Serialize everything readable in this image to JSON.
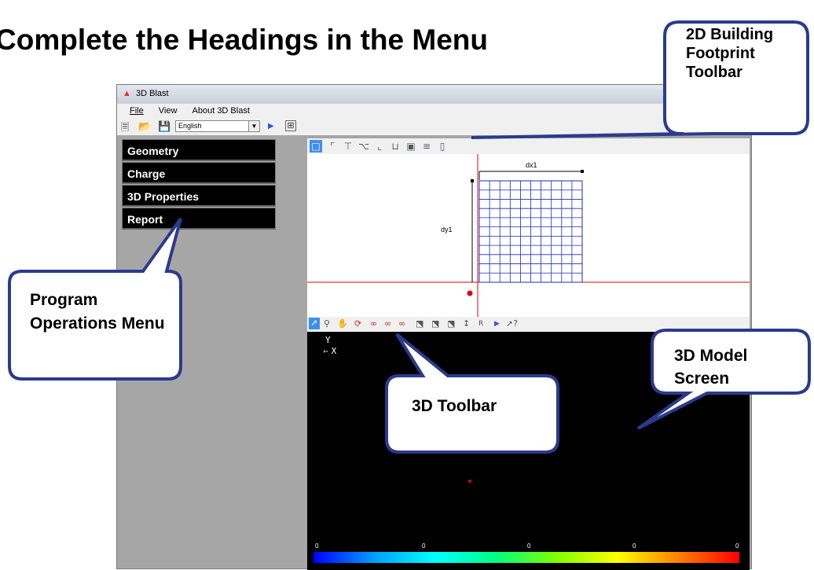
{
  "slide": {
    "title": "Complete the Headings in the Menu"
  },
  "window": {
    "title": "3D Blast",
    "menus": [
      "File",
      "View",
      "About 3D Blast"
    ],
    "language": "English"
  },
  "left_menu": {
    "items": [
      "Geometry",
      "Charge",
      "3D Properties",
      "Report"
    ]
  },
  "footprint": {
    "dx_label": "dx1",
    "dy_label": "dy1"
  },
  "screen3d": {
    "axis_y": "Y",
    "axis_x": "X",
    "scale_labels": [
      "0",
      "0",
      "0",
      "0",
      "0"
    ]
  },
  "callouts": {
    "footprint_toolbar": "2D Building Footprint Toolbar",
    "program_menu": "Program Operations Menu",
    "toolbar_3d": "3D Toolbar",
    "model_screen": "3D Model Screen"
  },
  "icons": [
    "new-file-icon",
    "open-folder-icon",
    "save-icon",
    "play-icon",
    "app-settings-icon",
    "rect-shape-icon",
    "l-shape-icon",
    "t-shape-icon",
    "z-shape-icon",
    "j-shape-icon",
    "u-shape-icon",
    "o-shape-icon",
    "e-shape-icon",
    "h-shape-icon",
    "pointer-icon",
    "zoom-icon",
    "pan-icon",
    "rotate-icon",
    "view-top-icon",
    "view-front-icon",
    "view-side-icon",
    "axis-icon",
    "reset-icon",
    "help-pointer-icon"
  ],
  "colors": {
    "callout_border": "#2b3a8f",
    "active_tool": "#3c8ff0",
    "grid": "#1e2bbf",
    "axis_line": "#e00000"
  }
}
